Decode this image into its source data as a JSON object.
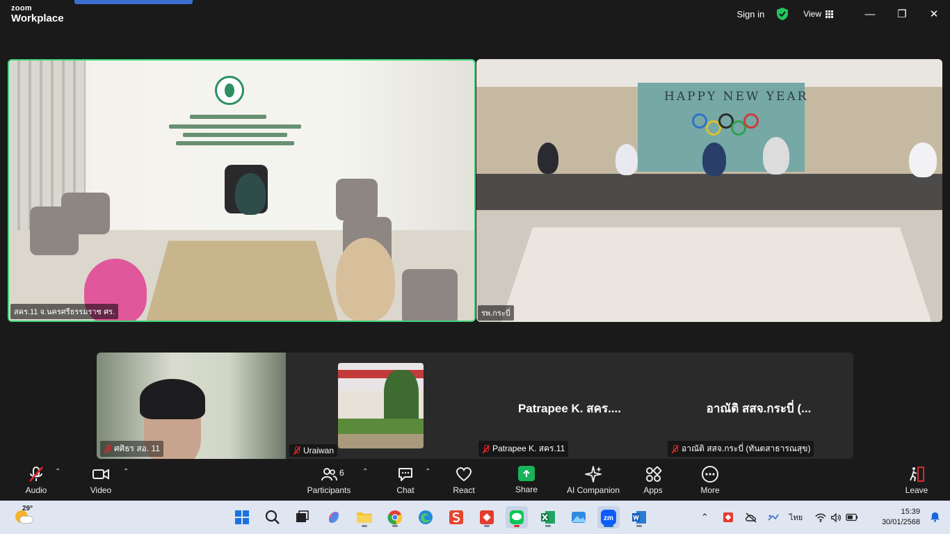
{
  "titlebar": {
    "brand_line1": "zoom",
    "brand_line2": "Workplace",
    "sign_in": "Sign in",
    "view": "View",
    "minimize": "—",
    "restore": "❐",
    "close": "✕"
  },
  "colors": {
    "active_speaker_border": "#3cd27a",
    "mute_red": "#e02828",
    "share_green": "#19b35a"
  },
  "main_tiles": [
    {
      "name": "สคร.11 จ.นครศรีธรรมราช ศร."
    },
    {
      "name": "รพ.กระบี่"
    }
  ],
  "scene": {
    "banner": "HAPPY NEW YEAR"
  },
  "gallery": [
    {
      "name": "ศศิธร สอ. 11",
      "muted": true
    },
    {
      "name": "Uraiwan",
      "muted": true
    },
    {
      "display": "Patrapee K. สคร....",
      "name": "Patrapee K. สคร.11",
      "muted": true
    },
    {
      "display": "อาณัติ สสจ.กระบี่ (...",
      "name": "อาณัติ สสจ.กระบี่ (ทันตสาธารณสุข)",
      "muted": true
    }
  ],
  "toolbar": {
    "audio": "Audio",
    "video": "Video",
    "participants": "Participants",
    "participants_count": "6",
    "chat": "Chat",
    "react": "React",
    "share": "Share",
    "ai_companion": "AI Companion",
    "apps": "Apps",
    "more": "More",
    "leave": "Leave"
  },
  "taskbar": {
    "weather_temp": "29°",
    "language": "ไทย",
    "time": "15:39",
    "date": "30/01/2568",
    "apps": [
      "start-icon",
      "search-icon",
      "task-view-icon",
      "copilot-icon",
      "file-explorer-icon",
      "chrome-icon",
      "edge-icon",
      "wps-icon",
      "anydesk-icon",
      "line-icon",
      "excel-icon",
      "photos-icon",
      "zoom-icon",
      "word-icon"
    ]
  }
}
